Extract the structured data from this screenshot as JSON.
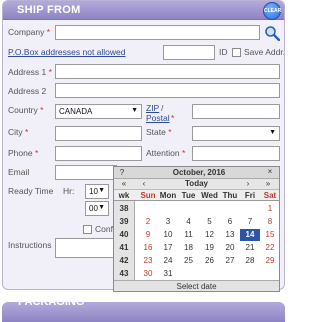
{
  "panel": {
    "title": "SHIP FROM",
    "clear_label": "CLEAR"
  },
  "labels": {
    "company": "Company",
    "po_box": "P.O.Box addresses not allowed",
    "id": "ID",
    "save_addr": "Save Addr.",
    "address1": "Address 1",
    "address2": "Address 2",
    "country": "Country",
    "zip": "ZIP",
    "postal": "Postal",
    "city": "City",
    "state": "State",
    "phone": "Phone",
    "attention": "Attention",
    "email": "Email",
    "ready_time": "Ready Time",
    "hr": "Hr:",
    "confirm": "Confi",
    "instructions": "Instructions",
    "req": "*"
  },
  "fields": {
    "country_value": "CANADA",
    "hour_value": "10",
    "minute_value": "00"
  },
  "calendar": {
    "help": "?",
    "prev_year": "«",
    "prev_month": "‹",
    "title": "October, 2016",
    "close": "×",
    "next_month": "›",
    "next_year": "»",
    "today": "Today",
    "headers": [
      "wk",
      "Sun",
      "Mon",
      "Tue",
      "Wed",
      "Thu",
      "Fri",
      "Sat"
    ],
    "rows": [
      [
        "38",
        "",
        "",
        "",
        "",
        "",
        "",
        "1"
      ],
      [
        "39",
        "2",
        "3",
        "4",
        "5",
        "6",
        "7",
        "8"
      ],
      [
        "40",
        "9",
        "10",
        "11",
        "12",
        "13",
        "14",
        "15"
      ],
      [
        "41",
        "16",
        "17",
        "18",
        "19",
        "20",
        "21",
        "22"
      ],
      [
        "42",
        "23",
        "24",
        "25",
        "26",
        "27",
        "28",
        "29"
      ],
      [
        "43",
        "30",
        "31",
        "",
        "",
        "",
        "",
        ""
      ]
    ],
    "selected": "14",
    "footer": "Select date",
    "weekend_color": "#c0392b",
    "selected_color": "#2c55a8"
  },
  "packaging": {
    "title": "PACKAGING"
  }
}
